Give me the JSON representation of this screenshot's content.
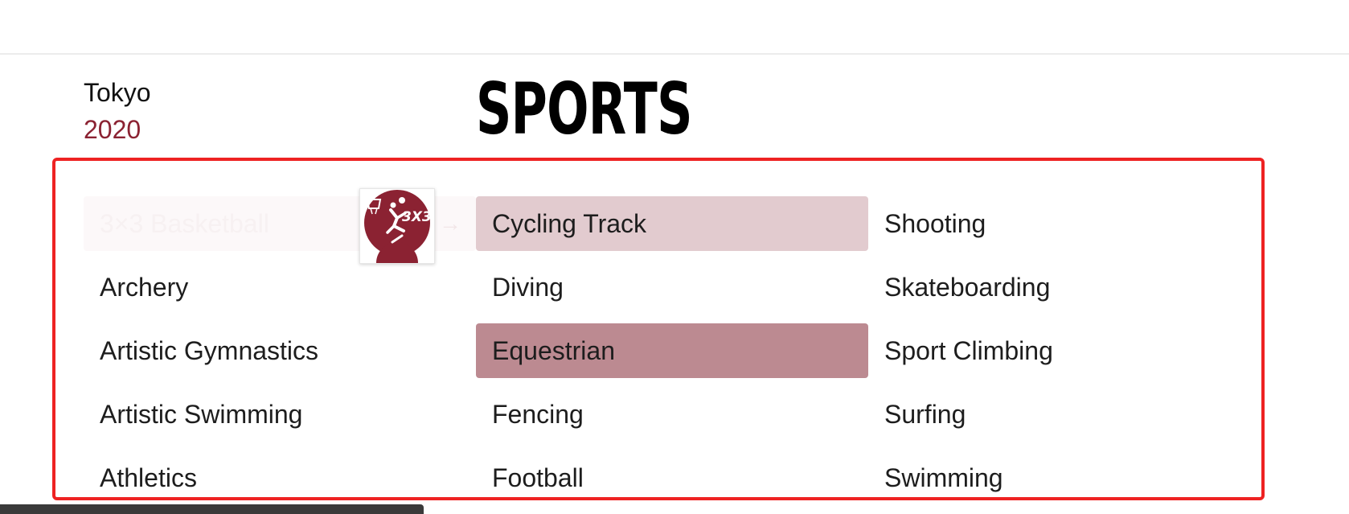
{
  "brand": {
    "city": "Tokyo",
    "year": "2020"
  },
  "page": {
    "title": "SPORTS"
  },
  "sports": [
    {
      "label": "3×3 Basketball",
      "state": "fading"
    },
    {
      "label": "Cycling Track",
      "state": "light"
    },
    {
      "label": "Shooting",
      "state": "normal"
    },
    {
      "label": "Archery",
      "state": "normal"
    },
    {
      "label": "Diving",
      "state": "normal"
    },
    {
      "label": "Skateboarding",
      "state": "normal"
    },
    {
      "label": "Artistic Gymnastics",
      "state": "normal"
    },
    {
      "label": "Equestrian",
      "state": "dark"
    },
    {
      "label": "Sport Climbing",
      "state": "normal"
    },
    {
      "label": "Artistic Swimming",
      "state": "normal"
    },
    {
      "label": "Fencing",
      "state": "normal"
    },
    {
      "label": "Surfing",
      "state": "normal"
    },
    {
      "label": "Athletics",
      "state": "normal"
    },
    {
      "label": "Football",
      "state": "normal"
    },
    {
      "label": "Swimming",
      "state": "normal"
    }
  ],
  "pictogram": {
    "icon": "basketball-3x3-icon",
    "text": "3X3"
  },
  "icons": {
    "arrow": "→"
  },
  "colors": {
    "accent": "#8b2232",
    "hover_light": "#e2cbcf",
    "hover_dark": "#bc8a91",
    "frame": "#ee2222"
  }
}
